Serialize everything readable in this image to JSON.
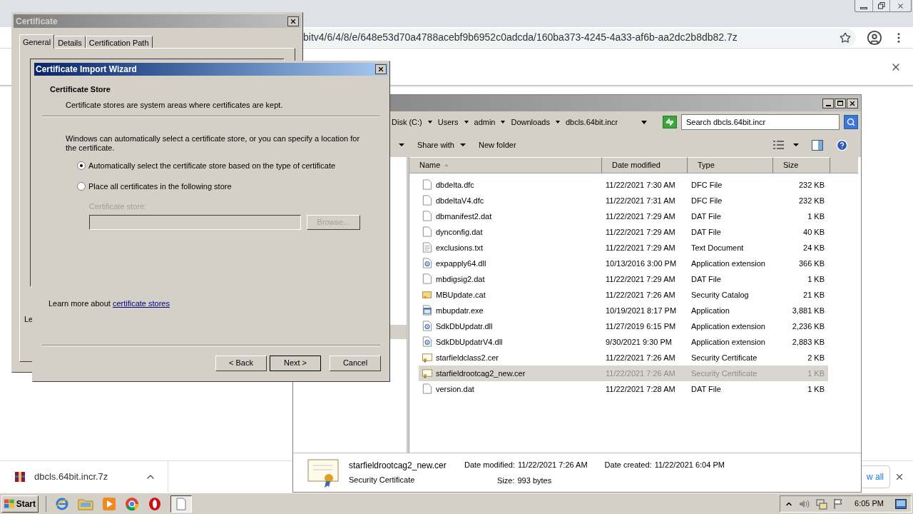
{
  "browser": {
    "address": "bitv4/6/4/8/e/648e53d70a4788acebf9b6952c0adcda/160ba373-4245-4a33-af6b-aa2dc2b8db82.7z",
    "download": "dbcls.64bit.incr.7z",
    "show_all": "w all"
  },
  "certificate_dialog": {
    "title": "Certificate",
    "tabs": [
      {
        "label": "General",
        "selected": true
      },
      {
        "label": "Details",
        "selected": false
      },
      {
        "label": "Certification Path",
        "selected": false
      }
    ],
    "partial_text": "Le"
  },
  "wizard": {
    "title": "Certificate Import Wizard",
    "heading": "Certificate Store",
    "subheading": "Certificate stores are system areas where certificates are kept.",
    "description": "Windows can automatically select a certificate store, or you can specify a location for the certificate.",
    "options": [
      {
        "label": "Automatically select the certificate store based on the type of certificate",
        "selected": true
      },
      {
        "label": "Place all certificates in the following store",
        "selected": false
      }
    ],
    "store": {
      "label": "Certificate store:",
      "browse": "Browse...",
      "disabled": true
    },
    "learn_more": "Learn more about ",
    "link": "certificate stores",
    "buttons": [
      {
        "label": "< Back",
        "default": false
      },
      {
        "label": "Next >",
        "default": true
      },
      {
        "label": "Cancel",
        "default": false
      }
    ]
  },
  "explorer": {
    "breadcrumbs": [
      "Disk (C:)",
      "Users",
      "admin",
      "Downloads",
      "dbcls.64bit.incr"
    ],
    "search_placeholder": "Search dbcls.64bit.incr",
    "toolbar": [
      "Share with",
      "New folder"
    ],
    "columns": [
      "Name",
      "Date modified",
      "Type",
      "Size"
    ],
    "rows": [
      {
        "name": "dbdelta.dfc",
        "date": "11/22/2021 7:30 AM",
        "type": "DFC File",
        "size": "232 KB",
        "kind": "file",
        "selected": false
      },
      {
        "name": "dbdeltaV4.dfc",
        "date": "11/22/2021 7:31 AM",
        "type": "DFC File",
        "size": "232 KB",
        "kind": "file",
        "selected": false
      },
      {
        "name": "dbmanifest2.dat",
        "date": "11/22/2021 7:29 AM",
        "type": "DAT File",
        "size": "1 KB",
        "kind": "file",
        "selected": false
      },
      {
        "name": "dynconfig.dat",
        "date": "11/22/2021 7:29 AM",
        "type": "DAT File",
        "size": "40 KB",
        "kind": "file",
        "selected": false
      },
      {
        "name": "exclusions.txt",
        "date": "11/22/2021 7:29 AM",
        "type": "Text Document",
        "size": "24 KB",
        "kind": "text",
        "selected": false
      },
      {
        "name": "expapply64.dll",
        "date": "10/13/2016 3:00 PM",
        "type": "Application extension",
        "size": "366 KB",
        "kind": "dll",
        "selected": false
      },
      {
        "name": "mbdigsig2.dat",
        "date": "11/22/2021 7:29 AM",
        "type": "DAT File",
        "size": "1 KB",
        "kind": "file",
        "selected": false
      },
      {
        "name": "MBUpdate.cat",
        "date": "11/22/2021 7:26 AM",
        "type": "Security Catalog",
        "size": "21 KB",
        "kind": "catalog",
        "selected": false
      },
      {
        "name": "mbupdatr.exe",
        "date": "10/19/2021 8:17 PM",
        "type": "Application",
        "size": "3,881 KB",
        "kind": "exe",
        "selected": false
      },
      {
        "name": "SdkDbUpdatr.dll",
        "date": "11/27/2019 6:15 PM",
        "type": "Application extension",
        "size": "2,236 KB",
        "kind": "dll",
        "selected": false
      },
      {
        "name": "SdkDbUpdatrV4.dll",
        "date": "9/30/2021 9:30 PM",
        "type": "Application extension",
        "size": "2,883 KB",
        "kind": "dll",
        "selected": false
      },
      {
        "name": "starfieldclass2.cer",
        "date": "11/22/2021 7:26 AM",
        "type": "Security Certificate",
        "size": "2 KB",
        "kind": "cert",
        "selected": false
      },
      {
        "name": "starfieldrootcag2_new.cer",
        "date": "11/22/2021 7:26 AM",
        "type": "Security Certificate",
        "size": "1 KB",
        "kind": "cert",
        "selected": true
      },
      {
        "name": "version.dat",
        "date": "11/22/2021 7:28 AM",
        "type": "DAT File",
        "size": "1 KB",
        "kind": "file",
        "selected": false
      }
    ],
    "details": {
      "name": "starfieldrootcag2_new.cer",
      "type": "Security Certificate",
      "fields": [
        {
          "label": "Date modified:",
          "value": "11/22/2021 7:26 AM"
        },
        {
          "label": "Size:",
          "value": "993 bytes"
        },
        {
          "label": "Date created:",
          "value": "11/22/2021 6:04 PM"
        }
      ]
    }
  },
  "taskbar": {
    "start": "Start",
    "time": "6:05 PM"
  }
}
